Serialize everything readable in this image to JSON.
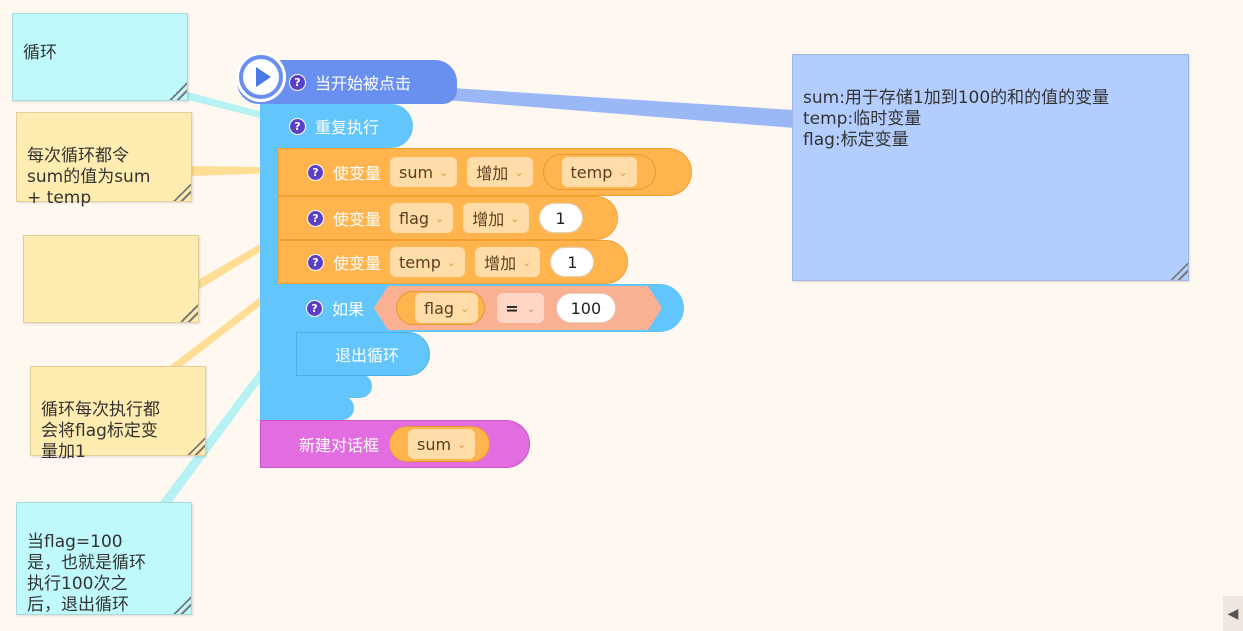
{
  "notes": {
    "loop": "循环",
    "sum_note": "每次循环都令\nsum的值为sum\n+ temp",
    "empty": "",
    "flag_note": "循环每次执行都\n会将flag标定变\n量加1",
    "exit_note": "当flag=100\n是，也就是循环\n执行100次之\n后，退出循环",
    "vars_note": "sum:用于存储1加到100的和的值的变量\ntemp:临时变量\nflag:标定变量"
  },
  "blocks": {
    "hat_label": "当开始被点击",
    "repeat_label": "重复执行",
    "set_label": "使变量",
    "set1": {
      "var": "sum",
      "op": "增加",
      "value_var": "temp"
    },
    "set2": {
      "var": "flag",
      "op": "增加",
      "value": "1"
    },
    "set3": {
      "var": "temp",
      "op": "增加",
      "value": "1"
    },
    "if_label": "如果",
    "cond": {
      "var": "flag",
      "op": "=",
      "value": "100"
    },
    "break_label": "退出循环",
    "dialog_label": "新建对话框",
    "dialog_var": "sum"
  },
  "icons": {
    "help": "?",
    "chevron": "⌄",
    "collapse": "◀"
  },
  "colors": {
    "event": "#6990f0",
    "control": "#62c5fb",
    "variable": "#ffb44d",
    "operator": "#f9b093",
    "dialog": "#e26de0",
    "note_cyan": "#bff9fb",
    "note_yellow": "#ffecb0",
    "note_blue": "#b3cdfe"
  }
}
